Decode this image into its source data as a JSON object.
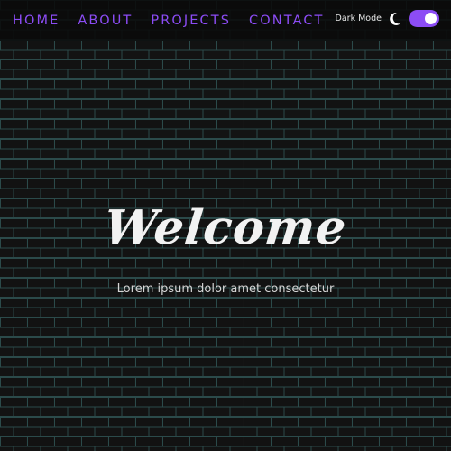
{
  "navbar": {
    "links": [
      "HOME",
      "ABOUT",
      "PROJECTS",
      "CONTACT"
    ],
    "toggle_label": "Dark Mode",
    "toggle_state": "on",
    "toggle_icon": "moon-icon"
  },
  "hero": {
    "title": "Welcome",
    "subtitle": "Lorem ipsum dolor amet consectetur"
  },
  "colors": {
    "accent": "#8c4cf5",
    "background": "#141414",
    "mortar": "#2b4a4a",
    "text": "#f2f2f2"
  }
}
